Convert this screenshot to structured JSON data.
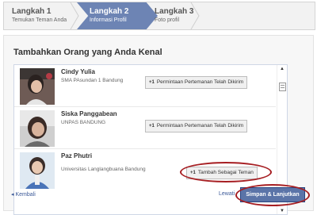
{
  "steps": [
    {
      "title": "Langkah 1",
      "subtitle": "Temukan Teman Anda"
    },
    {
      "title": "Langkah 2",
      "subtitle": "Informasi Profil"
    },
    {
      "title": "Langkah 3",
      "subtitle": "Foto profil"
    }
  ],
  "panel": {
    "heading": "Tambahkan Orang yang Anda Kenal"
  },
  "people": [
    {
      "name": "Cindy Yulia",
      "school": "SMA PAsundan 1 Bandung",
      "button_icon": "+1",
      "button_label": "Permintaan Pertemanan Telah Dikirim"
    },
    {
      "name": "Siska Panggabean",
      "school": "UNPAS BANDUNG",
      "button_icon": "+1",
      "button_label": "Permintaan Pertemanan Telah Dikirim"
    },
    {
      "name": "Paz Phutri",
      "school": "Universitas Langlangbuana Bandung",
      "button_icon": "+1",
      "button_label": "Tambah Sebagai Teman"
    }
  ],
  "footer": {
    "back_label": "Kembali",
    "skip_label": "Lewati",
    "save_label": "Simpan & Lanjutkan"
  },
  "colors": {
    "active_step": "#6d84b4",
    "link": "#3b5998",
    "primary_button": "#5b74a8",
    "highlight_ring": "#a61e22"
  }
}
